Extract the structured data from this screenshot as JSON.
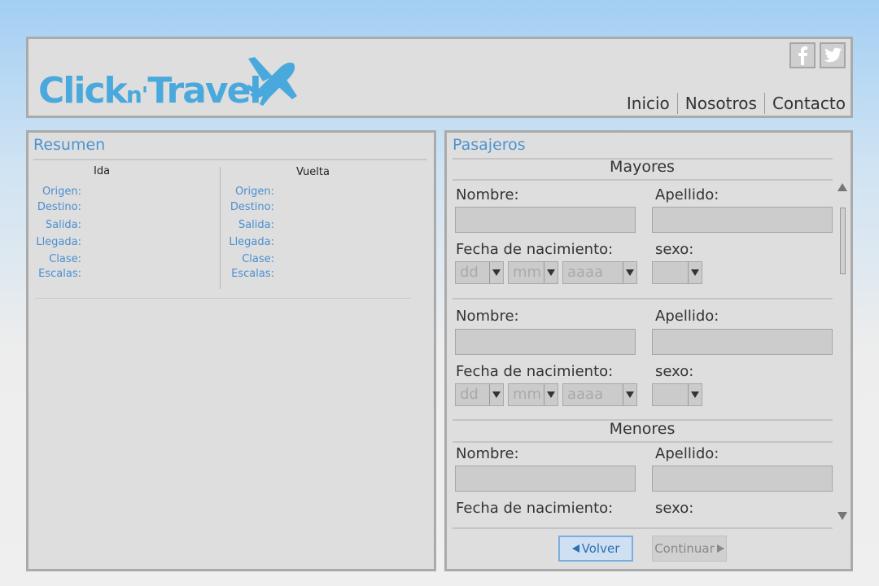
{
  "header": {
    "logo": {
      "part1": "Click",
      "part2": "n'",
      "part3": "Travel"
    },
    "social": [
      {
        "name": "facebook",
        "icon": "facebook-icon"
      },
      {
        "name": "twitter",
        "icon": "twitter-icon"
      }
    ],
    "nav": [
      "Inicio",
      "Nosotros",
      "Contacto"
    ]
  },
  "resumen": {
    "title": "Resumen",
    "ida": {
      "heading": "Ida",
      "labels": [
        "Origen:",
        "Destino:",
        "Salida:",
        "Llegada:",
        "Clase:",
        "Escalas:"
      ]
    },
    "vuelta": {
      "heading": "Vuelta",
      "labels": [
        "Origen:",
        "Destino:",
        "Salida:",
        "Llegada:",
        "Clase:",
        "Escalas:"
      ]
    }
  },
  "pasajeros": {
    "title": "Pasajeros",
    "mayores": "Mayores",
    "menores": "Menores",
    "labels": {
      "nombre": "Nombre:",
      "apellido": "Apellido:",
      "fecha": "Fecha de nacimiento:",
      "sexo": "sexo:"
    },
    "date_placeholders": {
      "day": "dd",
      "month": "mm",
      "year": "aaaa"
    },
    "buttons": {
      "back": "Volver",
      "next": "Continuar"
    }
  },
  "colors": {
    "accent": "#4a94d4",
    "logo": "#4aa9dc",
    "panel": "#dedede",
    "border": "#aaaaaa"
  }
}
